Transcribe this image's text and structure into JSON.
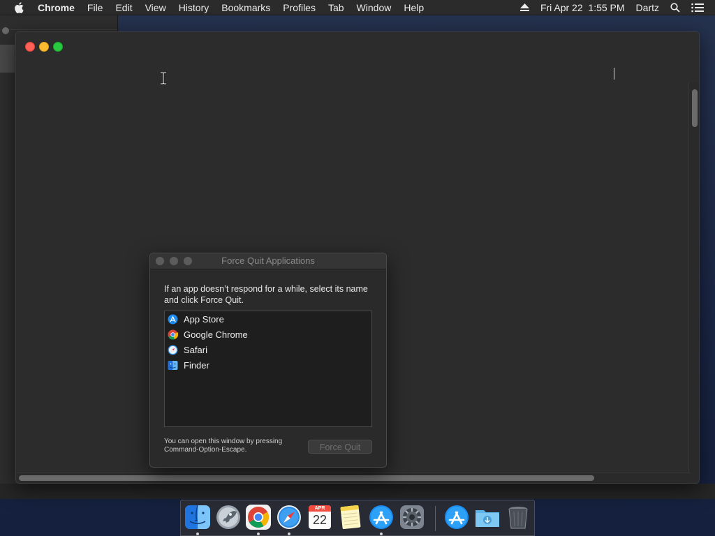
{
  "menubar": {
    "apple_icon": "apple-logo-icon",
    "app_name": "Chrome",
    "items": [
      "File",
      "Edit",
      "View",
      "History",
      "Bookmarks",
      "Profiles",
      "Tab",
      "Window",
      "Help"
    ],
    "datetime": "Fri Apr 22  1:55 PM",
    "user": "Dartz",
    "icons": [
      "eject-icon",
      "spotlight-search-icon",
      "notification-center-icon"
    ]
  },
  "force_quit": {
    "title": "Force Quit Applications",
    "description": "If an app doesn’t respond for a while, select its name and click Force Quit.",
    "apps": [
      {
        "name": "App Store",
        "icon": "app-store-icon"
      },
      {
        "name": "Google Chrome",
        "icon": "chrome-icon"
      },
      {
        "name": "Safari",
        "icon": "safari-icon"
      },
      {
        "name": "Finder",
        "icon": "finder-icon"
      }
    ],
    "footer": "You can open this window by pressing Command-Option-Escape.",
    "button": "Force Quit",
    "button_enabled": false
  },
  "dock": {
    "items": [
      {
        "name": "Finder",
        "icon": "finder-icon",
        "running": true
      },
      {
        "name": "Launchpad",
        "icon": "launchpad-icon",
        "running": false
      },
      {
        "name": "Google Chrome",
        "icon": "chrome-icon",
        "running": true
      },
      {
        "name": "Safari",
        "icon": "safari-icon",
        "running": true
      },
      {
        "name": "Calendar",
        "icon": "calendar-icon",
        "running": false,
        "month": "APR",
        "day": "22"
      },
      {
        "name": "Notes",
        "icon": "notes-icon",
        "running": false
      },
      {
        "name": "App Store",
        "icon": "app-store-icon",
        "running": true
      },
      {
        "name": "System Preferences",
        "icon": "system-preferences-icon",
        "running": false
      },
      {
        "name": "Applications",
        "icon": "app-store-folder-icon",
        "running": false
      },
      {
        "name": "Downloads",
        "icon": "downloads-folder-icon",
        "running": false
      },
      {
        "name": "Trash",
        "icon": "trash-icon",
        "running": false
      }
    ]
  },
  "colors": {
    "close": "#fe5f57",
    "minimize": "#febc2e",
    "maximize": "#28c840"
  }
}
